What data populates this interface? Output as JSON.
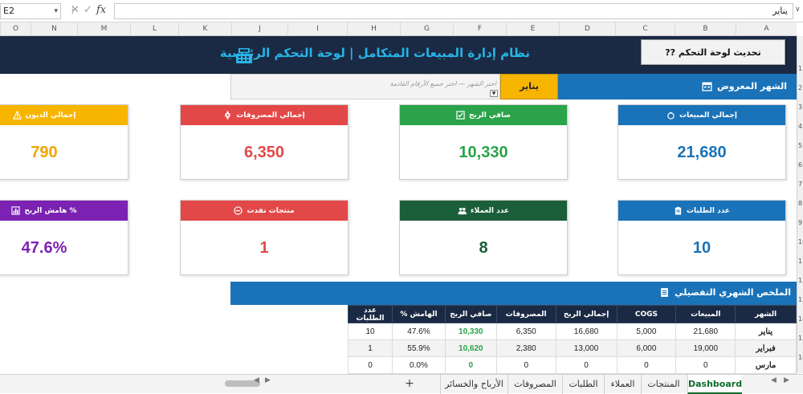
{
  "formula_bar": {
    "name_box": "E2",
    "fx": "fx",
    "formula": "يناير"
  },
  "columns": [
    "O",
    "N",
    "M",
    "L",
    "K",
    "J",
    "I",
    "H",
    "G",
    "F",
    "E",
    "D",
    "C",
    "B",
    "A"
  ],
  "row_numbers": [
    "1",
    "2",
    "3",
    "4",
    "5",
    "6",
    "7",
    "8",
    "9",
    "10",
    "11",
    "12",
    "13",
    "14",
    "15",
    "16",
    "17"
  ],
  "header": {
    "title": "نظام إدارة المبيعات المتكامل | لوحة التحكم الرئيسية",
    "refresh_button": "تحديث لوحة التحكم ??"
  },
  "month_row": {
    "label": "الشهر المعروض",
    "selected_month": "يناير",
    "hint": "اختر الشهر — اختر جميع الأرقام القادمة"
  },
  "cards": [
    {
      "label": "إجمالي المبيعات",
      "value": "21,680",
      "icon": "money-bag-icon",
      "header_color": "#1a73b8",
      "value_color": "#1a73b8"
    },
    {
      "label": "صافي الربح",
      "value": "10,330",
      "icon": "checkbox-icon",
      "header_color": "#2aa34a",
      "value_color": "#2aa34a"
    },
    {
      "label": "إجمالي المصروفات",
      "value": "6,350",
      "icon": "gear-icon",
      "header_color": "#e34848",
      "value_color": "#e34848"
    },
    {
      "label": "إجمالي الديون",
      "value": "790",
      "icon": "warning-icon",
      "header_color": "#f7b500",
      "value_color": "#f0a500"
    },
    {
      "label": "عدد الطلبات",
      "value": "10",
      "icon": "clipboard-icon",
      "header_color": "#1a73b8",
      "value_color": "#1a73b8"
    },
    {
      "label": "عدد العملاء",
      "value": "8",
      "icon": "users-icon",
      "header_color": "#1b5e3a",
      "value_color": "#1b5e3a"
    },
    {
      "label": "منتجات نفدت",
      "value": "1",
      "icon": "no-entry-icon",
      "header_color": "#e34848",
      "value_color": "#e34848"
    },
    {
      "label": "% هامش الربح",
      "value": "47.6%",
      "icon": "bar-chart-icon",
      "header_color": "#7b22b3",
      "value_color": "#7b22b3"
    }
  ],
  "summary": {
    "label": "الملخص الشهري التفصيلي",
    "headers": [
      "الشهر",
      "المبيعات",
      "COGS",
      "إجمالي الربح",
      "المصروفات",
      "صافي الربح",
      "الهامش %",
      "عدد الطلبات"
    ],
    "rows": [
      [
        "يناير",
        "21,680",
        "5,000",
        "16,680",
        "6,350",
        "10,330",
        "47.6%",
        "10"
      ],
      [
        "فبراير",
        "19,000",
        "6,000",
        "13,000",
        "2,380",
        "10,620",
        "55.9%",
        "1"
      ],
      [
        "مارس",
        "0",
        "0",
        "0",
        "0",
        "0",
        "0.0%",
        "0"
      ]
    ]
  },
  "sheet_tabs": [
    "Dashboard",
    "المنتجات",
    "العملاء",
    "الطلبات",
    "المصروفات",
    "الأرباح والخسائر"
  ],
  "active_tab": "Dashboard",
  "add_sheet": "+"
}
